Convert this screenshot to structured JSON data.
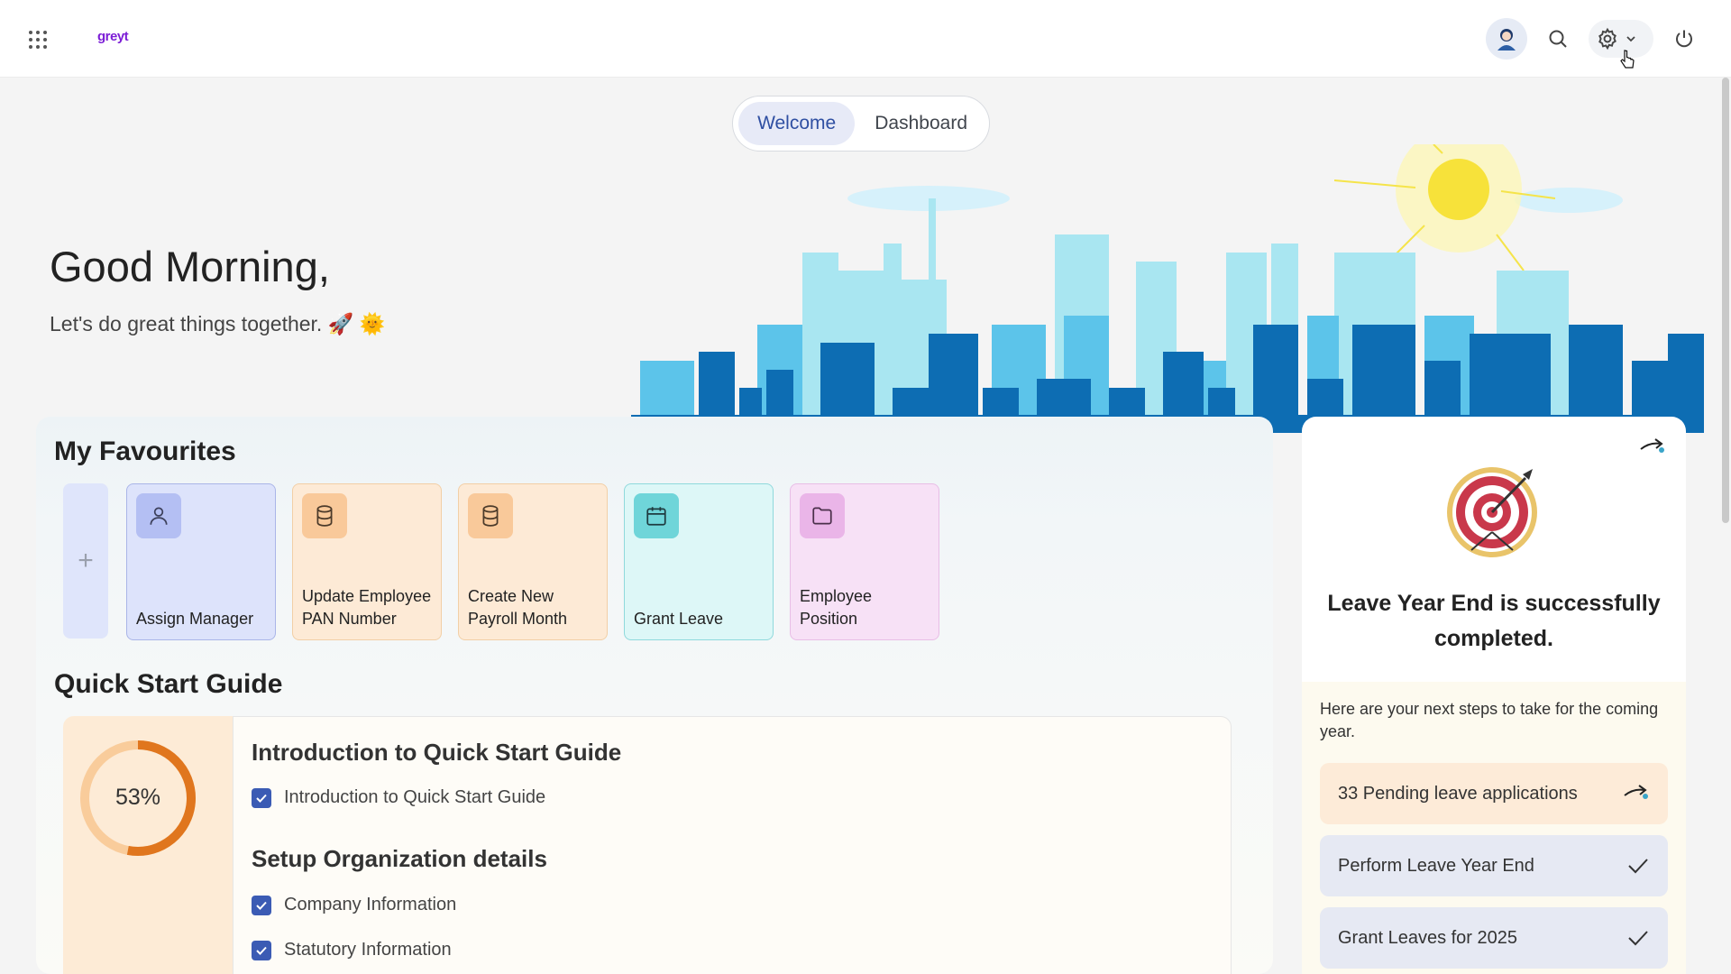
{
  "app": {
    "logo_text": "greyt"
  },
  "header": {
    "apps_icon": "grid-icon",
    "profile_icon": "avatar",
    "search_icon": "search-icon",
    "settings_icon": "gear-icon",
    "settings_menu_icon": "chevron-down-icon",
    "power_icon": "power-icon"
  },
  "tabs": [
    {
      "label": "Welcome",
      "active": true
    },
    {
      "label": "Dashboard",
      "active": false
    }
  ],
  "greeting": {
    "title": "Good Morning,",
    "subtitle": "Let's do great things together. 🚀 🌞"
  },
  "favourites": {
    "title": "My Favourites",
    "add_label": "+",
    "items": [
      {
        "label": "Assign Manager",
        "icon": "user-icon",
        "color": "#dde3fb"
      },
      {
        "label": "Update Employee PAN Number",
        "icon": "database-icon",
        "color": "#fdead6"
      },
      {
        "label": "Create New Payroll Month",
        "icon": "database-icon",
        "color": "#fdead6"
      },
      {
        "label": "Grant Leave",
        "icon": "calendar-icon",
        "color": "#ddf7f7"
      },
      {
        "label": "Employee Position",
        "icon": "folder-icon",
        "color": "#f7e1f6"
      }
    ]
  },
  "quick_start": {
    "title": "Quick Start Guide",
    "progress": 53,
    "progress_label": "53%",
    "sections": [
      {
        "heading": "Introduction to Quick Start Guide",
        "items": [
          "Introduction to Quick Start Guide"
        ]
      },
      {
        "heading": "Setup Organization details",
        "items": [
          "Company Information",
          "Statutory Information"
        ]
      }
    ]
  },
  "leave_card": {
    "title": "Leave Year End is successfully completed.",
    "intro": "Here are your next steps to take for the coming year.",
    "steps": [
      {
        "label": "33 Pending leave applications",
        "status": "pending"
      },
      {
        "label": "Perform Leave Year End",
        "status": "done"
      },
      {
        "label": "Grant Leaves for 2025",
        "status": "done"
      }
    ]
  },
  "colors": {
    "accent": "#3b5bb4",
    "progress_ring": "#e0761e",
    "progress_track": "#f9cc9b"
  }
}
